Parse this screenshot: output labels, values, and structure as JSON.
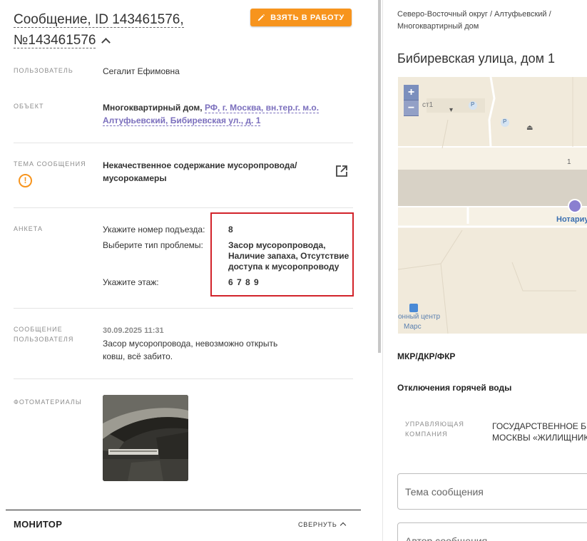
{
  "ticket": {
    "title": "Сообщение, ID 143461576, №143461576",
    "take_button": "ВЗЯТЬ В РАБОТУ"
  },
  "fields": {
    "user_label": "ПОЛЬЗОВАТЕЛЬ",
    "user_value": "Сегалит Ефимовна",
    "object_label": "ОБЪЕКТ",
    "object_prefix": "Многоквартирный дом,",
    "object_link_line1": "РФ, г. Москва, вн.тер.г. м.о.",
    "object_link_line2": "Алтуфьевский, Бибиревская ул., д. 1",
    "topic_label": "ТЕМА СООБЩЕНИЯ",
    "topic_line1": "Некачественное содержание мусоропровода/",
    "topic_line2": "мусорокамеры",
    "anketa_label": "АНКЕТА",
    "user_message_label_1": "СООБЩЕНИЕ",
    "user_message_label_2": "ПОЛЬЗОВАТЕЛЯ",
    "message_date": "30.09.2025 11:31",
    "message_text_line1": "Засор мусоропровода, невозможно открыть",
    "message_text_line2": "ковш, всё забито.",
    "photos_label": "ФОТОМАТЕРИАЛЫ"
  },
  "anketa": {
    "q1": "Укажите номер подъезда:",
    "a1": "8",
    "q2": "Выберите тип проблемы:",
    "a2_line1": "Засор мусоропровода,",
    "a2_line2": "Наличие запаха, Отсутствие",
    "a2_line3": "доступа к мусоропроводу",
    "q3": "Укажите этаж:",
    "a3": "6 7 8 9"
  },
  "monitor": {
    "title": "МОНИТОР",
    "collapse": "СВЕРНУТЬ"
  },
  "right": {
    "breadcrumb_line1": "Северо-Восточный округ / Алтуфьевский /",
    "breadcrumb_line2": "Многоквартирный дом",
    "address": "Бибиревская улица, дом 1",
    "map": {
      "zoom_in": "+",
      "zoom_out": "−",
      "label_stop": "ст1",
      "label_house": "1",
      "label_notary": "Нотариу",
      "label_center_1": "онный центр",
      "label_center_2": "Марс",
      "label_p": "P"
    },
    "mkr": "МКР/ДКР/ФКР",
    "hot_water": "Отключения горячей воды",
    "mc_label_1": "УПРАВЛЯЮЩАЯ",
    "mc_label_2": "КОМПАНИЯ",
    "mc_value_1": "ГОСУДАРСТВЕННОЕ БК",
    "mc_value_2": "МОСКВЫ «ЖИЛИЩНИК",
    "topic_placeholder": "Тема сообщения",
    "author_placeholder": "Автор сообщения"
  },
  "colors": {
    "accent_orange": "#f7941d",
    "link_purple": "#7b6fbd",
    "highlight_red": "#d2232a"
  }
}
